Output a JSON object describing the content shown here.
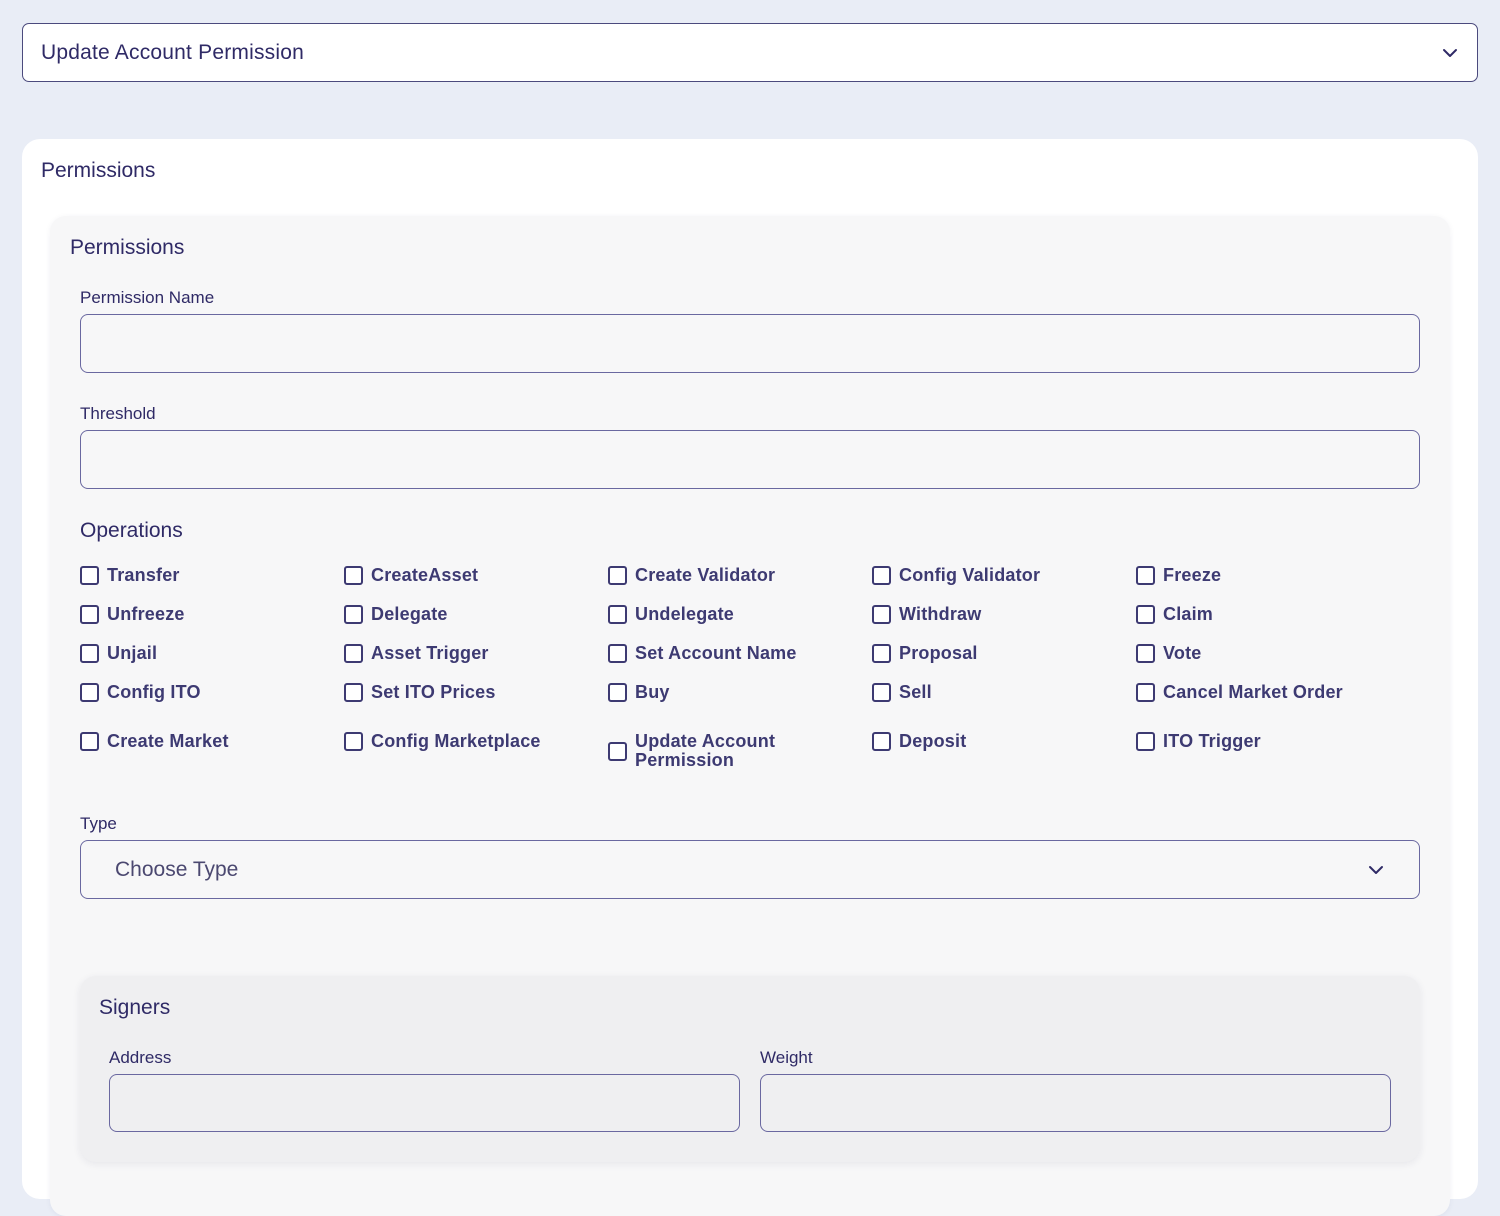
{
  "header_select": {
    "label": "Update Account Permission",
    "icon": "chevron-down-icon"
  },
  "outer_card": {
    "title": "Permissions"
  },
  "inner_card": {
    "title": "Permissions",
    "permission_name": {
      "label": "Permission Name",
      "value": "",
      "placeholder": ""
    },
    "threshold": {
      "label": "Threshold",
      "value": "",
      "placeholder": ""
    }
  },
  "operations": {
    "title": "Operations",
    "items": [
      {
        "label": "Transfer",
        "checked": false
      },
      {
        "label": "CreateAsset",
        "checked": false
      },
      {
        "label": "Create Validator",
        "checked": false
      },
      {
        "label": "Config Validator",
        "checked": false
      },
      {
        "label": "Freeze",
        "checked": false
      },
      {
        "label": "Unfreeze",
        "checked": false
      },
      {
        "label": "Delegate",
        "checked": false
      },
      {
        "label": "Undelegate",
        "checked": false
      },
      {
        "label": "Withdraw",
        "checked": false
      },
      {
        "label": "Claim",
        "checked": false
      },
      {
        "label": "Unjail",
        "checked": false
      },
      {
        "label": "Asset Trigger",
        "checked": false
      },
      {
        "label": "Set Account Name",
        "checked": false
      },
      {
        "label": "Proposal",
        "checked": false
      },
      {
        "label": "Vote",
        "checked": false
      },
      {
        "label": "Config ITO",
        "checked": false
      },
      {
        "label": "Set ITO Prices",
        "checked": false
      },
      {
        "label": "Buy",
        "checked": false
      },
      {
        "label": "Sell",
        "checked": false
      },
      {
        "label": "Cancel Market Order",
        "checked": false
      },
      {
        "label": "Create Market",
        "checked": false
      },
      {
        "label": "Config Marketplace",
        "checked": false
      },
      {
        "label": "Update Account Permission",
        "checked": false
      },
      {
        "label": "Deposit",
        "checked": false
      },
      {
        "label": "ITO Trigger",
        "checked": false
      }
    ]
  },
  "type": {
    "label": "Type",
    "placeholder": "Choose Type",
    "icon": "chevron-down-icon"
  },
  "signers": {
    "title": "Signers",
    "address": {
      "label": "Address",
      "value": ""
    },
    "weight": {
      "label": "Weight",
      "value": ""
    }
  },
  "colors": {
    "page_bg": "#e9edf6",
    "text": "#2f2a66",
    "border": "#6a68a0"
  }
}
